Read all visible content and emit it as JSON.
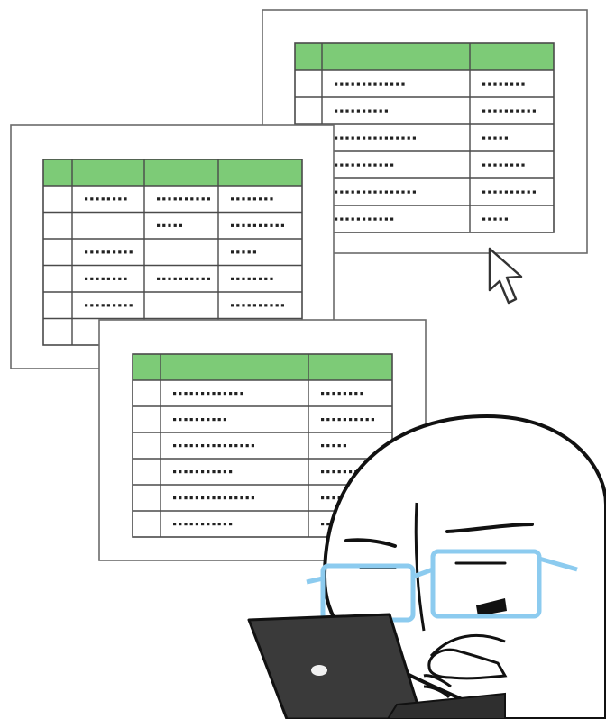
{
  "colors": {
    "header": "#7dcb77",
    "line": "#4a4a4a",
    "paper": "#ffffff",
    "paper_border": "#6a6a6a",
    "glasses": "#8ccbef",
    "laptop": "#3a3a3a"
  },
  "documents": [
    {
      "id": "back-right",
      "rows": [
        [
          "",
          "long",
          "short"
        ],
        [
          "",
          "medium",
          "medium"
        ],
        [
          "",
          "xlong",
          "tiny"
        ],
        [
          "",
          "medium2",
          "short"
        ],
        [
          "",
          "xlong",
          "medium"
        ],
        [
          "",
          "medium2",
          "tiny"
        ]
      ]
    },
    {
      "id": "middle-left",
      "rows": [
        [
          "",
          "short",
          "medium",
          "short"
        ],
        [
          "",
          "",
          "tiny",
          "medium"
        ],
        [
          "",
          "short2",
          "",
          "tiny"
        ],
        [
          "",
          "short",
          "medium",
          "short"
        ],
        [
          "",
          "short2",
          "",
          "medium"
        ],
        [
          "",
          "",
          "",
          ""
        ]
      ]
    },
    {
      "id": "front-center",
      "rows": [
        [
          "",
          "long",
          "short"
        ],
        [
          "",
          "medium",
          "medium"
        ],
        [
          "",
          "xlong",
          "tiny"
        ],
        [
          "",
          "medium2",
          "short"
        ],
        [
          "",
          "xlong",
          "medium"
        ],
        [
          "",
          "medium2",
          "tiny"
        ]
      ]
    }
  ],
  "icons": [
    "mouse-cursor-icon",
    "laptop-icon",
    "apple-logo-icon"
  ],
  "character": {
    "wears_glasses": true,
    "expression": "frowning"
  }
}
